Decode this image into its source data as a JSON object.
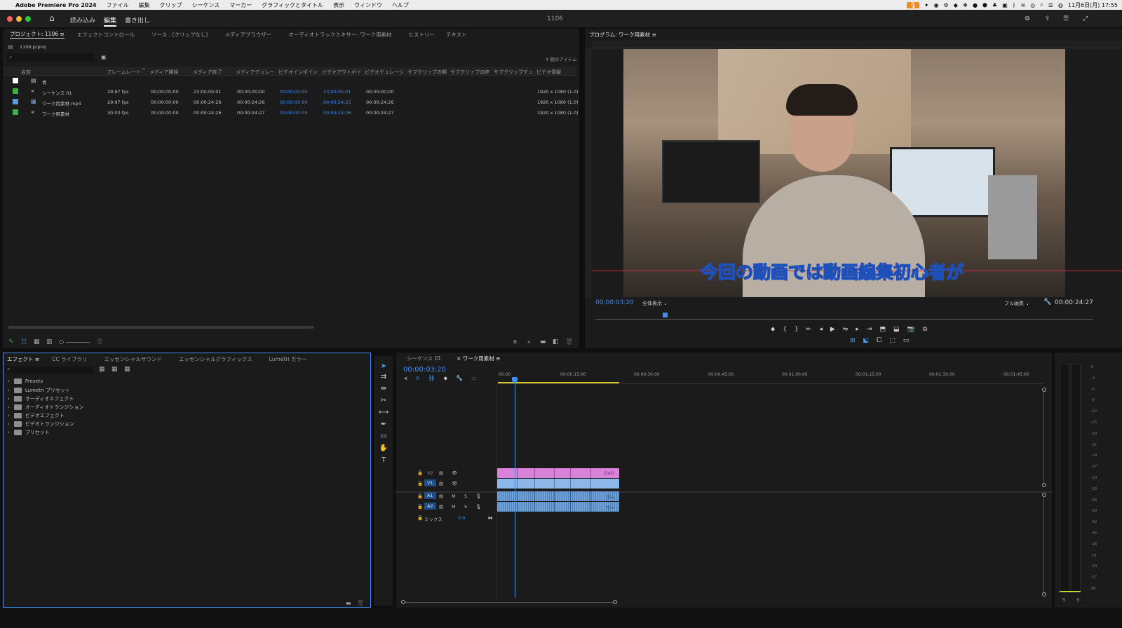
{
  "menubar": {
    "app_name": "Adobe Premiere Pro 2024",
    "items": [
      "ファイル",
      "編集",
      "クリップ",
      "シーケンス",
      "マーカー",
      "グラフィックとタイトル",
      "表示",
      "ウィンドウ",
      "ヘルプ"
    ],
    "datetime": "11月6日(月) 17:55"
  },
  "titlebar": {
    "workspaces": [
      "読み込み",
      "編集",
      "書き出し"
    ],
    "title": "1106"
  },
  "project_panel": {
    "tabs": [
      "プロジェクト: 1106",
      "エフェクトコントロール",
      "ソース : (クリップなし)",
      "メディアブラウザー",
      "オーディオトラックミキサー: ワーク用素材",
      "ヒストリー",
      "テキスト"
    ],
    "file_name": "1106.prproj",
    "item_count": "4 個のアイテム",
    "columns": [
      "名前",
      "フレームレート",
      "メディア開始",
      "メディア終了",
      "メディアデュレー",
      "ビデオインポイン",
      "ビデオアウトポイ",
      "ビデオデュレーシ",
      "サブクリップの開",
      "サブクリップの終",
      "サブクリップデュ",
      "ビデオ情報"
    ],
    "rows": [
      {
        "name": "青",
        "fps": "",
        "start": "",
        "end": "",
        "dur": "",
        "in": "",
        "out": "",
        "vdur": "",
        "info": ""
      },
      {
        "name": "シーケンス 01",
        "fps": "29.97 fps",
        "start": "00;00;00;00",
        "end": "23;00;00;01",
        "dur": "00;00;00;00",
        "in": "00;00;00;00",
        "out": "23;00;00;01",
        "vdur": "00;00;00;00",
        "info": "1920 x 1080 (1.0)"
      },
      {
        "name": "ワーク用素材.mp4",
        "fps": "29.97 fps",
        "start": "00:00:00:00",
        "end": "00:00:24:26",
        "dur": "00:00:24:26",
        "in": "00:00:00:00",
        "out": "00:00:24:25",
        "vdur": "00:00:24:26",
        "info": "1920 x 1080 (1.0)"
      },
      {
        "name": "ワーク用素材",
        "fps": "30.00 fps",
        "start": "00:00:00:00",
        "end": "00:00:24:26",
        "dur": "00:00:24:27",
        "in": "00:00:00:00",
        "out": "00:00:24:26",
        "vdur": "00:00:24:27",
        "info": "1920 x 1080 (1.0)"
      }
    ]
  },
  "program_monitor": {
    "tab": "プログラム: ワーク用素材",
    "subtitle": "今回の動画では動画編集初心者が",
    "timecode": "00:00:03:20",
    "fit": "全体表示",
    "quality": "フル画質",
    "duration": "00:00:24:27",
    "playhead_fraction": 0.14
  },
  "effects_panel": {
    "tabs": [
      "エフェクト",
      "CC ライブラリ",
      "エッセンシャルサウンド",
      "エッセンシャルグラフィックス",
      "Lumetri カラー"
    ],
    "folders": [
      "Presets",
      "Lumetri プリセット",
      "オーディオエフェクト",
      "オーディオトランジション",
      "ビデオエフェクト",
      "ビデオトランジション",
      "プリセット"
    ]
  },
  "timeline": {
    "tabs": [
      "シーケンス 01",
      "ワーク用素材"
    ],
    "timecode": "00:00:03:20",
    "ruler": [
      "00:00",
      "00:00:15:00",
      "00:00:30:00",
      "00:00:45:00",
      "00:01:00:00",
      "00:01:15:00",
      "00:01:30:00",
      "00:01:45:00"
    ],
    "tracks": [
      {
        "id": "V2",
        "type": "video"
      },
      {
        "id": "V1",
        "type": "video"
      },
      {
        "id": "A1",
        "type": "audio"
      },
      {
        "id": "A2",
        "type": "audio"
      }
    ],
    "mix_label": "ミックス",
    "mix_value": "0.0",
    "v2_clip_label": "Outl",
    "a_clip_label": "ワー",
    "colors": {
      "v2": "#d67fd8",
      "v1": "#8fb8e8",
      "audio": "#7aa8d8",
      "accent": "#3d8cf0"
    }
  },
  "meters": {
    "labels": [
      "0",
      "-3",
      "-6",
      "-9",
      "-12",
      "-15",
      "-18",
      "-21",
      "-24",
      "-27",
      "-30",
      "-33",
      "-36",
      "-39",
      "-42",
      "-45",
      "-48",
      "-51",
      "-54",
      "-57",
      "dB"
    ],
    "solo": [
      "S",
      "S"
    ]
  }
}
